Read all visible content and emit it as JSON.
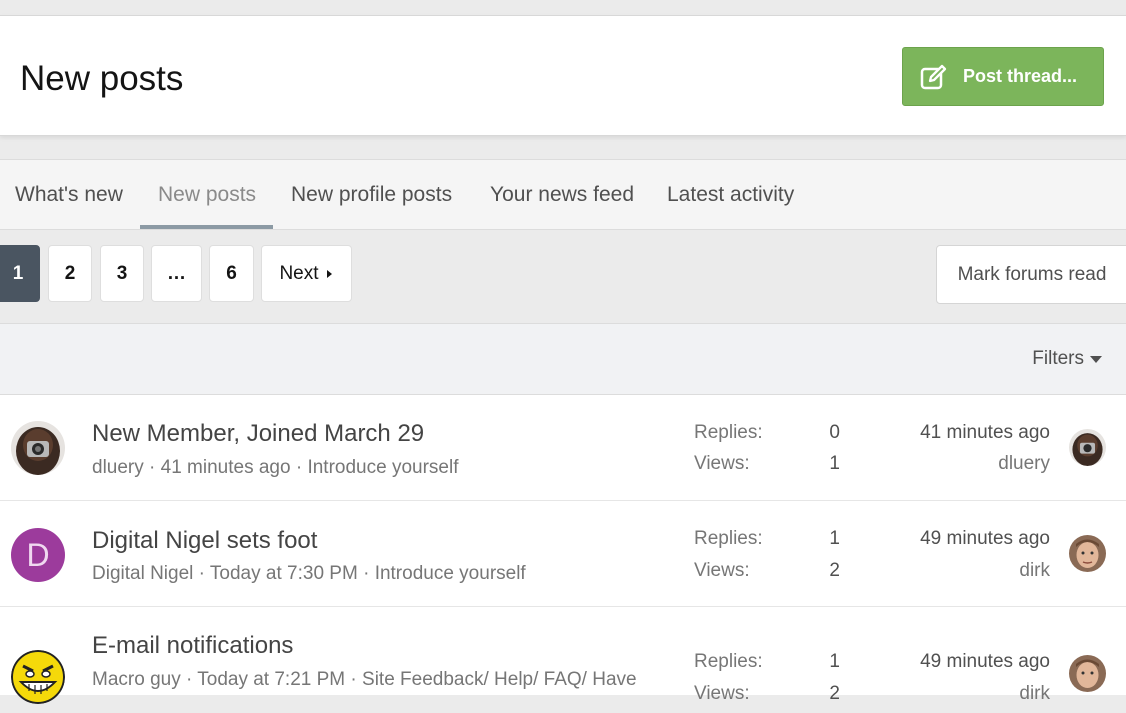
{
  "header": {
    "title": "New posts",
    "post_thread_label": "Post thread..."
  },
  "tabs": [
    {
      "label": "What's new",
      "active": false
    },
    {
      "label": "New posts",
      "active": true
    },
    {
      "label": "New profile posts",
      "active": false
    },
    {
      "label": "Your news feed",
      "active": false
    },
    {
      "label": "Latest activity",
      "active": false
    }
  ],
  "pagination": {
    "pages": [
      "1",
      "2",
      "3",
      "…",
      "6"
    ],
    "current": "1",
    "next_label": "Next"
  },
  "mark_forums_read_label": "Mark forums read",
  "filters_label": "Filters",
  "stats_labels": {
    "replies": "Replies:",
    "views": "Views:"
  },
  "threads": [
    {
      "title": "New Member, Joined March 29",
      "author": "dluery",
      "started": "41 minutes ago",
      "forum": "Introduce yourself",
      "replies": "0",
      "views": "1",
      "last_post_time": "41 minutes ago",
      "last_poster": "dluery",
      "avatar": "camera-photo-avatar"
    },
    {
      "title": "Digital Nigel sets foot",
      "author": "Digital Nigel",
      "started": "Today at 7:30 PM",
      "forum": "Introduce yourself",
      "replies": "1",
      "views": "2",
      "last_post_time": "49 minutes ago",
      "last_poster": "dirk",
      "avatar_letter": "D"
    },
    {
      "title": "E-mail notifications",
      "author": "Macro guy",
      "started": "Today at 7:21 PM",
      "forum": "Site Feedback/ Help/ FAQ/ Have",
      "replies": "1",
      "views": "2",
      "last_post_time": "49 minutes ago",
      "last_poster": "dirk",
      "avatar": "grin-smiley-avatar"
    }
  ],
  "colors": {
    "primary_button": "#7cb55b",
    "current_page": "#4a5561",
    "letter_avatar": "#9c3b9c",
    "tab_underline": "#8c9aa4"
  }
}
